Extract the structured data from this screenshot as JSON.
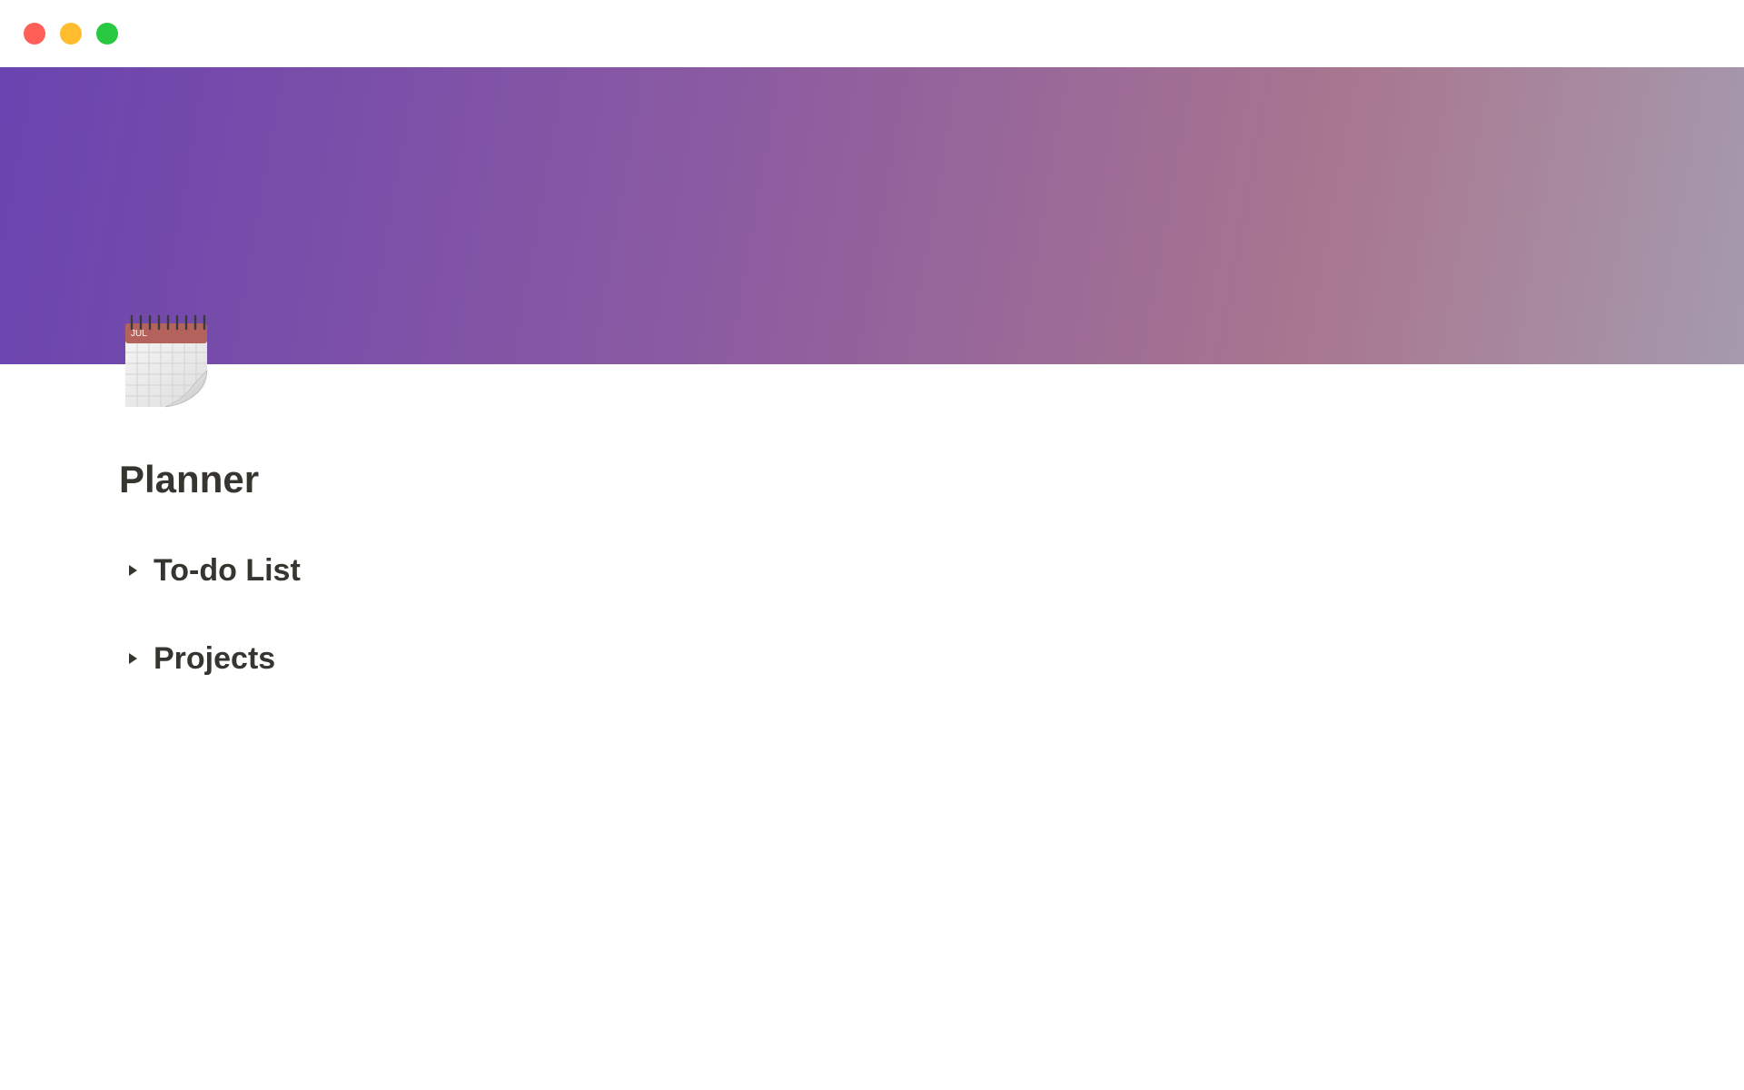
{
  "window": {
    "controls": {
      "close_color": "#ff5f57",
      "minimize_color": "#febc2e",
      "zoom_color": "#28c840"
    }
  },
  "cover": {
    "gradient_colors": [
      "#6a44b0",
      "#8a5aa2",
      "#a8768f",
      "#a69aad"
    ]
  },
  "page": {
    "icon": "spiral-calendar-icon",
    "calendar_month": "JUL",
    "title": "Planner",
    "toggles": [
      {
        "label": "To-do List",
        "expanded": false
      },
      {
        "label": "Projects",
        "expanded": false
      }
    ]
  },
  "colors": {
    "text": "#37352f",
    "calendar_header": "#b3625c"
  }
}
